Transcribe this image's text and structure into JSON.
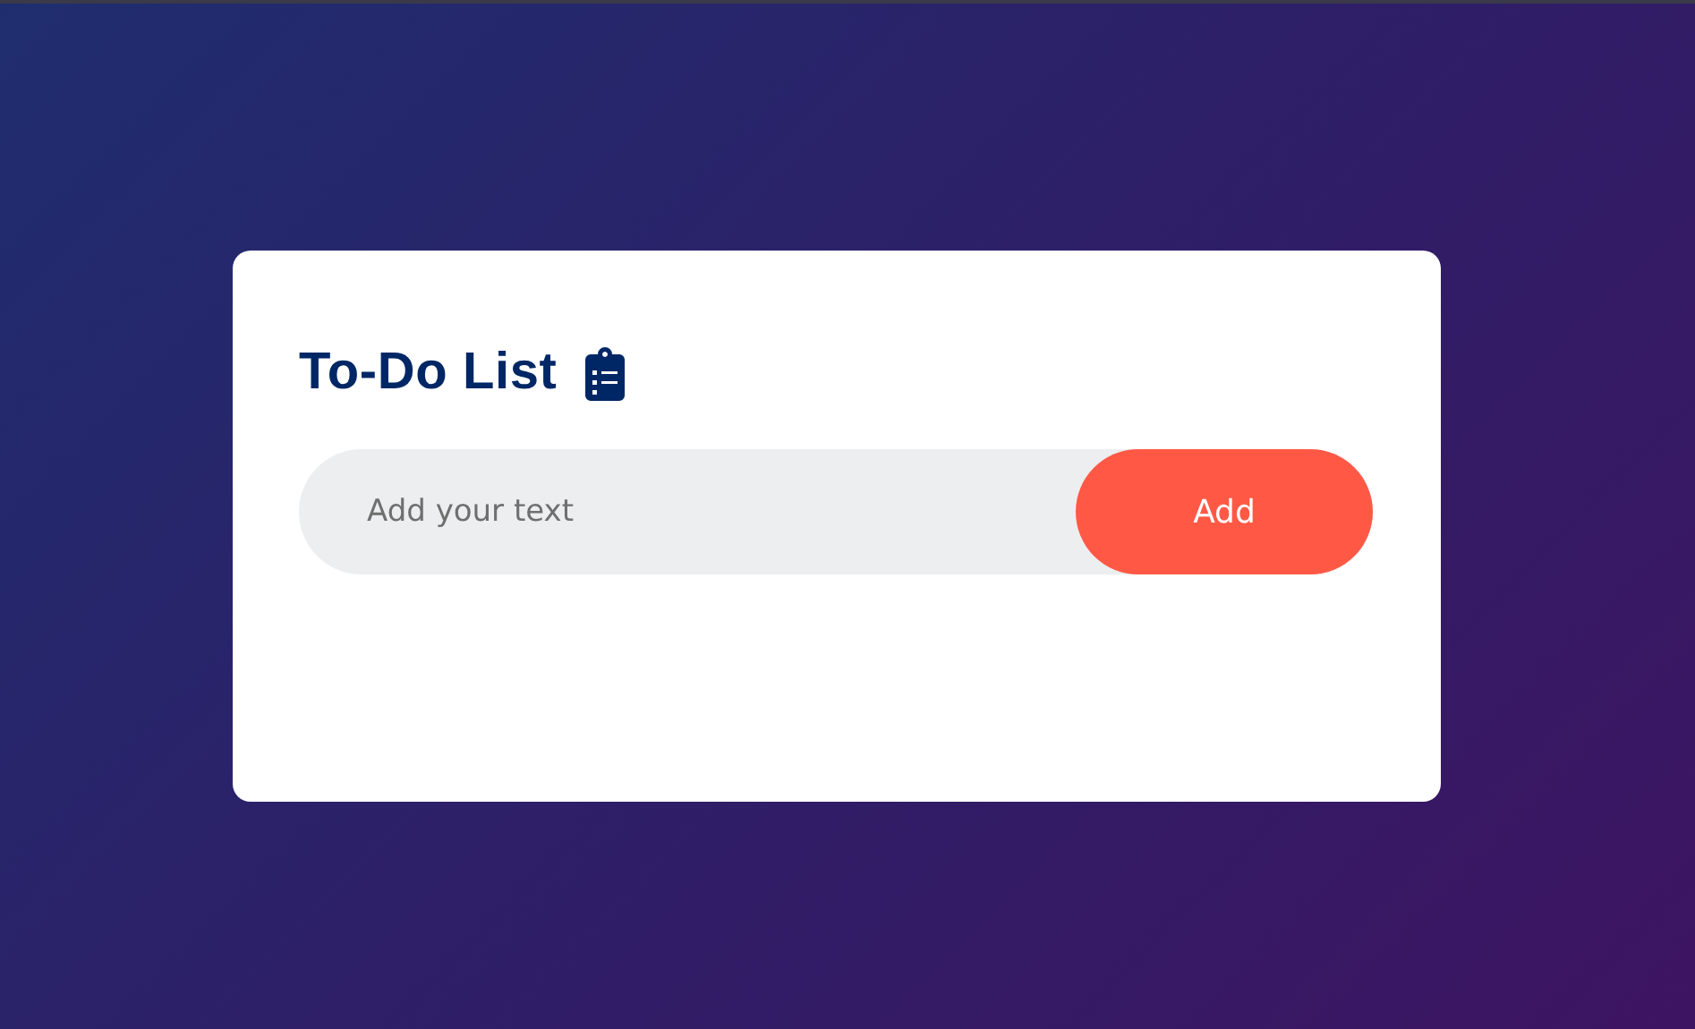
{
  "card": {
    "title": "To-Do List"
  },
  "input": {
    "placeholder": "Add your text"
  },
  "button": {
    "label": "Add"
  }
}
